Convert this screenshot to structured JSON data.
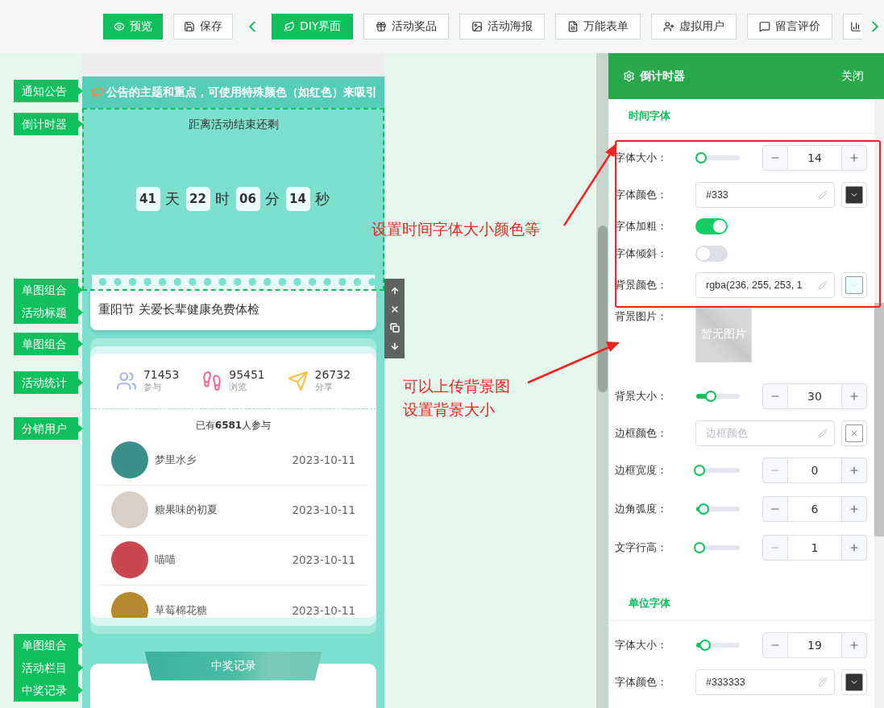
{
  "toolbar": {
    "preview": "预览",
    "save": "保存",
    "tabs": [
      {
        "label": "DIY界面",
        "selected": true
      },
      {
        "label": "活动奖品",
        "selected": false
      },
      {
        "label": "活动海报",
        "selected": false
      },
      {
        "label": "万能表单",
        "selected": false
      },
      {
        "label": "虚拟用户",
        "selected": false
      },
      {
        "label": "留言评价",
        "selected": false
      }
    ]
  },
  "component_tags": [
    {
      "lines": [
        "通知公告"
      ]
    },
    {
      "lines": [
        "倒计时器"
      ]
    },
    {
      "lines": [
        "单图组合",
        "活动标题"
      ]
    },
    {
      "lines": [
        "单图组合"
      ]
    },
    {
      "lines": [
        "活动统计"
      ]
    },
    {
      "lines": [
        "分销用户"
      ]
    },
    {
      "lines": [
        "单图组合",
        "活动栏目",
        "中奖记录"
      ]
    }
  ],
  "preview": {
    "notice": "公告的主题和重点，可使用特殊颜色（如红色）来吸引",
    "countdown": {
      "heading": "距离活动结束还剩",
      "parts": [
        {
          "value": "41",
          "unit": "天"
        },
        {
          "value": "22",
          "unit": "时"
        },
        {
          "value": "06",
          "unit": "分"
        },
        {
          "value": "14",
          "unit": "秒"
        }
      ]
    },
    "title": "重阳节 关爱长辈健康免费体检",
    "stats": [
      {
        "value": "71453",
        "label": "参与"
      },
      {
        "value": "95451",
        "label": "浏览"
      },
      {
        "value": "26732",
        "label": "分享"
      }
    ],
    "participants": {
      "summary": "已有**6581**人参与",
      "rows": [
        {
          "name": "梦里水乡",
          "date": "2023-10-11"
        },
        {
          "name": "糖果味的初夏",
          "date": "2023-10-11"
        },
        {
          "name": "喵喵",
          "date": "2023-10-11"
        },
        {
          "name": "草莓棉花糖",
          "date": "2023-10-11"
        }
      ]
    },
    "banner": "中奖记录"
  },
  "panel": {
    "title": "倒计时器",
    "close": "关闭",
    "sections": [
      {
        "title": "时间字体",
        "rows": [
          {
            "kind": "slider",
            "label": "字体大小：",
            "level": 0.05,
            "value": "14",
            "minus_disabled": false
          },
          {
            "kind": "color",
            "label": "字体颜色：",
            "value": "#333",
            "color": "#333333"
          },
          {
            "kind": "toggle",
            "label": "字体加粗：",
            "on": true
          },
          {
            "kind": "toggle",
            "label": "字体倾斜：",
            "on": false
          },
          {
            "kind": "color",
            "label": "背景颜色：",
            "value": "rgba(236, 255, 253, 1",
            "color": "#ecfffd"
          },
          {
            "kind": "image",
            "label": "背景图片：",
            "placeholder": "暂无图片"
          },
          {
            "kind": "slider",
            "label": "背景大小：",
            "level": 0.3,
            "value": "30",
            "minus_disabled": false
          },
          {
            "kind": "color",
            "label": "边框颜色：",
            "placeholder": "边框颜色"
          },
          {
            "kind": "slider",
            "label": "边框宽度：",
            "level": 0,
            "value": "0",
            "minus_disabled": true
          },
          {
            "kind": "slider",
            "label": "边角弧度：",
            "level": 0.1,
            "value": "6",
            "minus_disabled": false
          },
          {
            "kind": "slider",
            "label": "文字行高：",
            "level": 0,
            "value": "1",
            "minus_disabled": true
          }
        ]
      },
      {
        "title": "单位字体",
        "rows": [
          {
            "kind": "slider",
            "label": "字体大小：",
            "level": 0.15,
            "value": "19",
            "minus_disabled": false
          },
          {
            "kind": "color",
            "label": "字体颜色：",
            "value": "#333333",
            "color": "#333333"
          }
        ]
      }
    ]
  },
  "callouts": [
    {
      "lines": [
        "设置时间字体大小颜色等"
      ]
    },
    {
      "lines": [
        "可以上传背景图",
        "设置背景大小"
      ]
    }
  ]
}
